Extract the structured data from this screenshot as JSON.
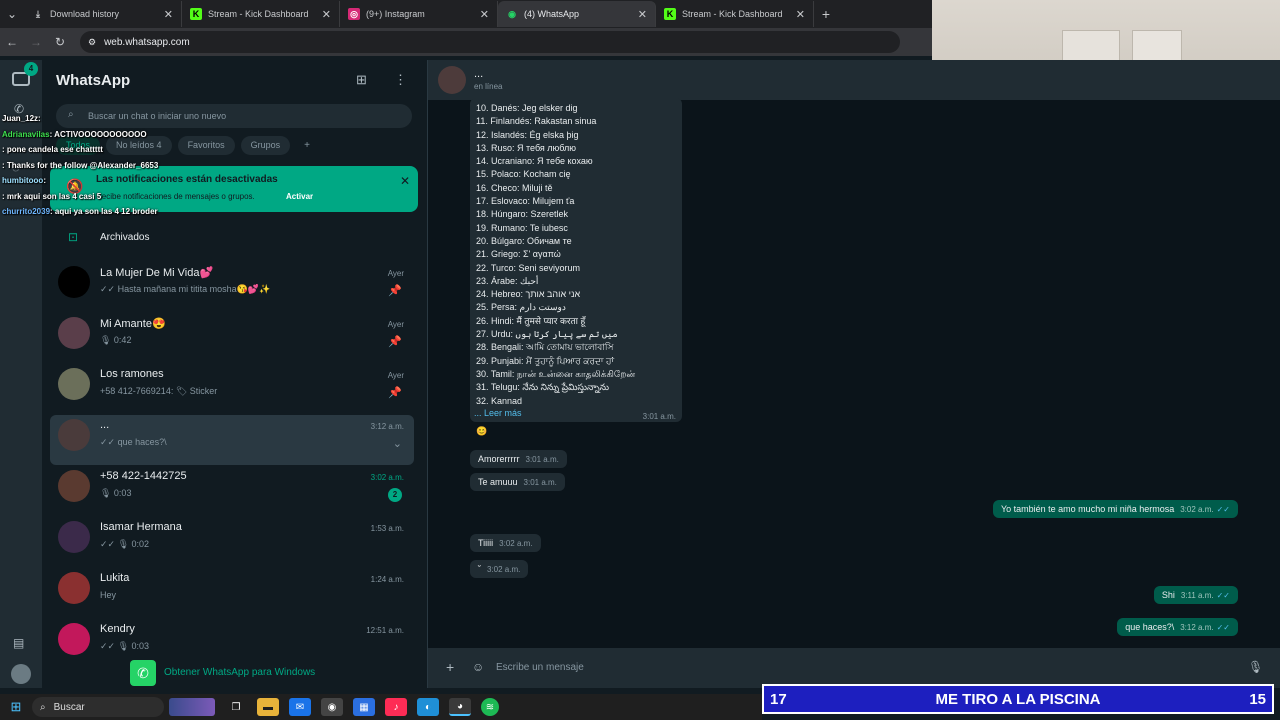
{
  "browser": {
    "tabs": [
      {
        "label": "Download history",
        "icon": "download-icon",
        "active": false
      },
      {
        "label": "Stream - Kick Dashboard",
        "icon": "kick-icon",
        "active": false
      },
      {
        "label": "(9+) Instagram",
        "icon": "instagram-icon",
        "active": false
      },
      {
        "label": "(4) WhatsApp",
        "icon": "whatsapp-icon",
        "active": true
      },
      {
        "label": "Stream - Kick Dashboard",
        "icon": "kick-icon",
        "active": false
      }
    ],
    "new_tab": "+",
    "url": "web.whatsapp.com"
  },
  "rail": {
    "badge": "4"
  },
  "sidebar": {
    "title": "WhatsApp",
    "search_placeholder": "Buscar un chat o iniciar uno nuevo",
    "filters": [
      "Todos",
      "No leídos 4",
      "Favoritos",
      "Grupos",
      "+"
    ],
    "notification": {
      "title": "Las notificaciones están desactivadas",
      "body": "Recibe notificaciones de mensajes o grupos.",
      "action": "Activar"
    },
    "archived": "Archivados",
    "chats": [
      {
        "name": "La Mujer De Mi Vida💕",
        "preview": "✓✓ Hasta mañana mi titita mosha😘💕✨",
        "time": "Ayer",
        "meta": "📌"
      },
      {
        "name": "Mi Amante😍",
        "preview": "🎙 0:42",
        "time": "Ayer",
        "meta": "📌"
      },
      {
        "name": "Los ramones",
        "preview": "+58 412-7669214: 🏷 Sticker",
        "time": "Ayer",
        "meta": "📌"
      },
      {
        "name": "...",
        "preview": "✓✓ que haces?\\",
        "time": "3:12 a.m.",
        "meta": "⌄"
      },
      {
        "name": "+58 422-1442725",
        "preview": "🎙 0:03",
        "time": "3:02 a.m.",
        "meta": "2"
      },
      {
        "name": "Isamar Hermana",
        "preview": "✓✓ 🎙 0:02",
        "time": "1:53 a.m.",
        "meta": ""
      },
      {
        "name": "Lukita",
        "preview": "Hey",
        "time": "1:24 a.m.",
        "meta": ""
      },
      {
        "name": "Kendry",
        "preview": "✓✓ 🎙 0:03",
        "time": "12:51 a.m.",
        "meta": ""
      }
    ],
    "get_app": "Obtener WhatsApp para Windows"
  },
  "chat": {
    "contact_name": "...",
    "status": "en línea",
    "long_message_lines": [
      "10. Danés: Jeg elsker dig",
      "11. Finlandés: Rakastan sinua",
      "12. Islandés: Ég elska þig",
      "13. Ruso: Я тебя люблю",
      "14. Ucraniano: Я тебе кохаю",
      "15. Polaco: Kocham cię",
      "16. Checo: Miluji tě",
      "17. Eslovaco: Milujem ťa",
      "18. Húngaro: Szeretlek",
      "19. Rumano: Te iubesc",
      "20. Búlgaro: Обичам те",
      "21. Griego: Σ' αγαπώ",
      "22. Turco: Seni seviyorum",
      "23. Árabe: أحبك",
      "24. Hebreo: אני אוהב אותך",
      "25. Persa: دوستت دارم",
      "26. Hindi: मैं तुमसे प्यार करता हूँ",
      "27. Urdu: میں تم سے پیار کرتا ہوں",
      "28. Bengali: আমি তোমায় ভালোবাসি",
      "29. Punjabi: ਮੈਂ ਤੁਹਾਨੂੰ ਪਿਆਰ ਕਰਦਾ ਹਾਂ",
      "30. Tamil: நான் உன்னை காதலிக்கிறேன்",
      "31. Telugu: నేను నిన్ను ప్రేమిస్తున్నాను",
      "32. Kannad"
    ],
    "read_more": "... Leer más",
    "long_message_time": "3:01 a.m.",
    "messages": [
      {
        "dir": "in",
        "text": "😊",
        "time": ""
      },
      {
        "dir": "in",
        "text": "Amorerrrrr",
        "time": "3:01 a.m."
      },
      {
        "dir": "in",
        "text": "Te amuuu",
        "time": "3:01 a.m."
      },
      {
        "dir": "out",
        "text": "Yo también te amo mucho mi niña hermosa",
        "time": "3:02 a.m."
      },
      {
        "dir": "in",
        "text": "Tiiiii",
        "time": "3:02 a.m."
      },
      {
        "dir": "in",
        "text": "˘",
        "time": "3:02 a.m."
      },
      {
        "dir": "out",
        "text": "Shi",
        "time": "3:11 a.m."
      },
      {
        "dir": "out",
        "text": "que haces?\\",
        "time": "3:12 a.m."
      }
    ],
    "input_placeholder": "Escribe un mensaje"
  },
  "stream_chat": [
    {
      "user": "Juan_12z",
      "text": ":",
      "color": "#ffffff"
    },
    {
      "user": "Adrianavilas",
      "text": ": ACTIVOOOOOOOOOOO",
      "color": "#3ee04f"
    },
    {
      "user": "",
      "text": ": pone candela ese chattttt",
      "color": "#ffffff"
    },
    {
      "user": "",
      "text": ": Thanks for the follow @Alexander_6653",
      "color": "#ff4d4d"
    },
    {
      "user": "humbitooo",
      "text": ":",
      "color": "#9ee0ff"
    },
    {
      "user": "",
      "text": ": mrk aqui son las 4 casi 5",
      "color": "#ff7eb6"
    },
    {
      "user": "churrito2039",
      "text": ": aqui ya son las 4 12 broder",
      "color": "#6fb7ff"
    }
  ],
  "taskbar": {
    "search": "Buscar"
  },
  "stream_bar": {
    "left": "17",
    "title": "ME TIRO A LA PISCINA",
    "right": "15"
  },
  "colors": {
    "accent": "#00a884",
    "bubble_out": "#005c4b",
    "bubble_in": "#202c33",
    "bg": "#0b141a",
    "stream_bar": "#1d1fbf"
  }
}
